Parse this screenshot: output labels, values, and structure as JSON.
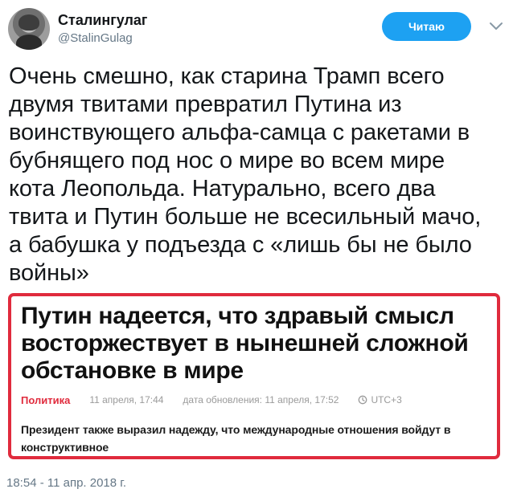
{
  "user": {
    "display_name": "Сталингулаг",
    "handle": "@StalinGulag"
  },
  "follow_button": {
    "label": "Читаю"
  },
  "tweet": {
    "text": "Очень смешно, как старина Трамп всего\nдвумя твитами превратил Путина из\nвоинствующего альфа-самца с ракетами в\nбубнящего под нос о мире во всем мире\nкота Леопольда. Натурально, всего два\nтвита и Путин больше не всесильный мачо,\nа бабушка у подъезда с «лишь бы не было\nвойны»",
    "timestamp": "18:54 - 11 апр. 2018 г."
  },
  "card": {
    "headline": "Путин надеется, что здравый смысл\nвосторжествует в нынешней сложной\nобстановке в мире",
    "category": "Политика",
    "date": "11 апреля, 17:44",
    "updated": "дата обновления: 11 апреля, 17:52",
    "timezone": "UTC+3",
    "body": "Президент также выразил надежду, что международные отношения войдут в конструктивное\nрусло, а вся мировая система станет более стабильной и прогнозируемой"
  },
  "colors": {
    "accent_blue": "#1da1f2",
    "card_red": "#e02b3d",
    "muted_gray": "#657786"
  },
  "icons": {
    "avatar": "user-avatar-icon",
    "menu": "chevron-down-icon",
    "clock": "clock-icon"
  }
}
